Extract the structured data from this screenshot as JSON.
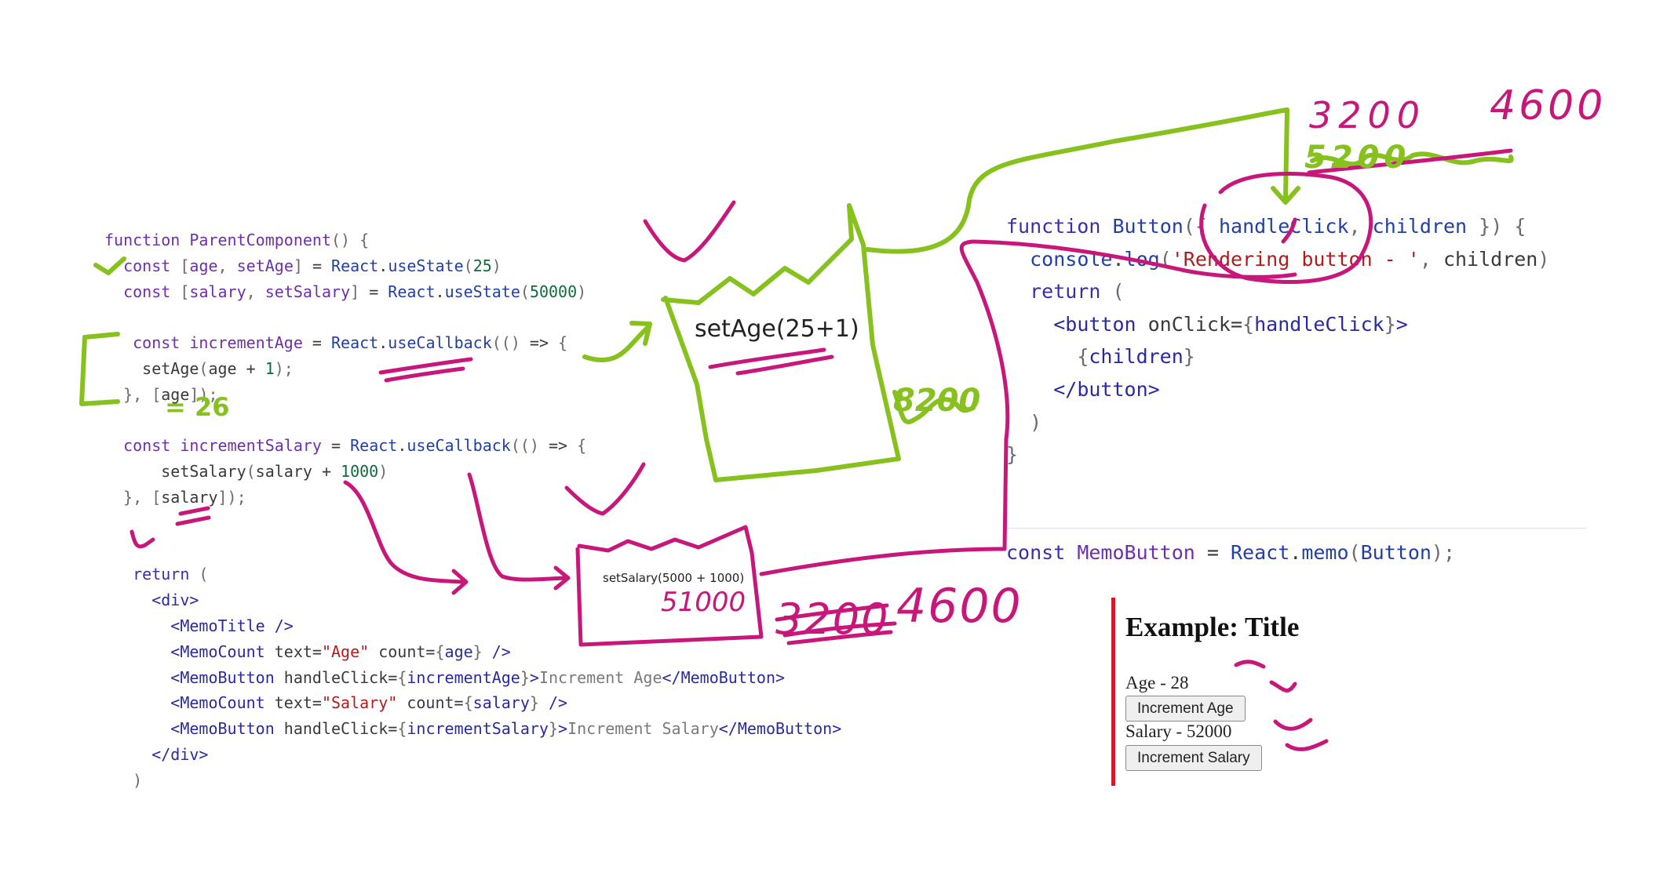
{
  "code_left": {
    "parent_fn": "ParentComponent",
    "age_var": "age",
    "set_age": "setAge",
    "age_init": "25",
    "salary_var": "salary",
    "set_salary": "setSalary",
    "salary_init": "50000",
    "inc_age": "incrementAge",
    "inc_salary": "incrementSalary",
    "age_step": "1",
    "salary_step": "1000",
    "memo_title": "MemoTitle",
    "memo_count": "MemoCount",
    "memo_button": "MemoButton",
    "age_text": "\"Age\"",
    "salary_text": "\"Salary\"",
    "age_button_text": "Increment Age",
    "salary_button_text": "Increment Salary"
  },
  "code_right": {
    "button_fn": "Button",
    "handle_click": "handleClick",
    "children": "children",
    "log_text": "'Rendering button - '",
    "memo_const": "MemoButton"
  },
  "annotations": {
    "set_age_box": "setAge(25+1)",
    "set_salary_box": "setSalary(5000 + 1000)",
    "eq26": "= 26",
    "num_3200_top": "3200",
    "num_4600_top": "4600",
    "num_5200_top": "5200",
    "num_3200_mid": "3200",
    "num_4600_mid": "4600",
    "num_51000": "51000",
    "num_8200": "8200"
  },
  "demo": {
    "title": "Example: Title",
    "age_line": "Age - 28",
    "age_button": "Increment Age",
    "salary_line": "Salary - 52000",
    "salary_button": "Increment Salary"
  },
  "colors": {
    "green_ink": "#86c11d",
    "magenta_ink": "#c8177a",
    "demo_bar": "#d21a2a"
  }
}
